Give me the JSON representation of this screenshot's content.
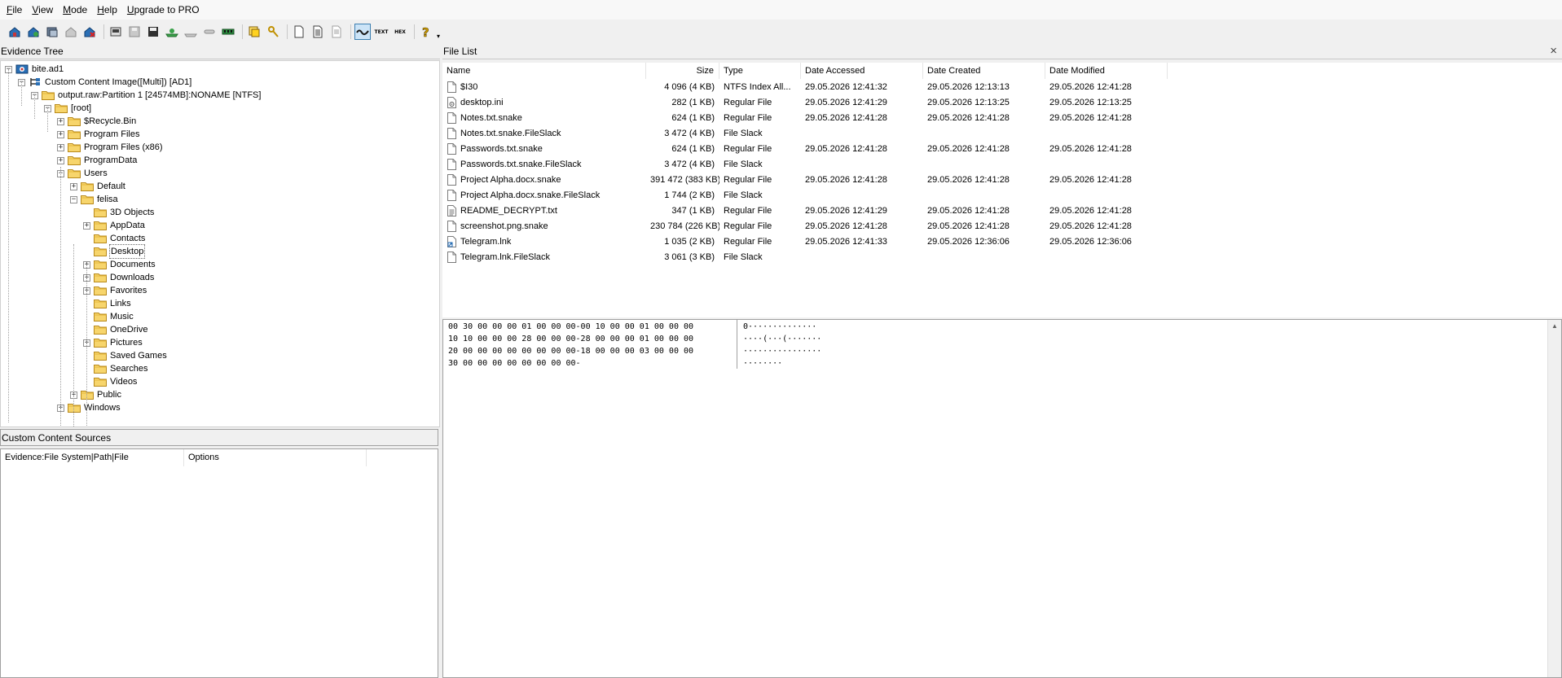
{
  "menu": [
    {
      "pre": "",
      "u": "F",
      "post": "ile"
    },
    {
      "pre": "",
      "u": "V",
      "post": "iew"
    },
    {
      "pre": "",
      "u": "M",
      "post": "ode"
    },
    {
      "pre": "",
      "u": "H",
      "post": "elp"
    },
    {
      "pre": "",
      "u": "U",
      "post": "pgrade to PRO"
    }
  ],
  "evidence_tree": {
    "title": "Evidence Tree",
    "nodes": [
      {
        "label": "bite.ad1",
        "level": 0,
        "exp": "-",
        "icon": "evidence-icon"
      },
      {
        "label": "Custom Content Image([Multi]) [AD1]",
        "level": 1,
        "exp": "-",
        "icon": "tree-icon"
      },
      {
        "label": "output.raw:Partition 1 [24574MB]:NONAME [NTFS]",
        "level": 2,
        "exp": "-",
        "icon": "folder-icon"
      },
      {
        "label": "[root]",
        "level": 3,
        "exp": "-",
        "icon": "folder-icon"
      },
      {
        "label": "$Recycle.Bin",
        "level": 4,
        "exp": "+",
        "icon": "folder-icon"
      },
      {
        "label": "Program Files",
        "level": 4,
        "exp": "+",
        "icon": "folder-icon"
      },
      {
        "label": "Program Files (x86)",
        "level": 4,
        "exp": "+",
        "icon": "folder-icon"
      },
      {
        "label": "ProgramData",
        "level": 4,
        "exp": "+",
        "icon": "folder-icon"
      },
      {
        "label": "Users",
        "level": 4,
        "exp": "-",
        "icon": "folder-icon"
      },
      {
        "label": "Default",
        "level": 5,
        "exp": "+",
        "icon": "folder-icon"
      },
      {
        "label": "felisa",
        "level": 5,
        "exp": "-",
        "icon": "folder-icon"
      },
      {
        "label": "3D Objects",
        "level": 6,
        "exp": "",
        "icon": "folder-icon"
      },
      {
        "label": "AppData",
        "level": 6,
        "exp": "+",
        "icon": "folder-icon"
      },
      {
        "label": "Contacts",
        "level": 6,
        "exp": "",
        "icon": "folder-icon"
      },
      {
        "label": "Desktop",
        "level": 6,
        "exp": "",
        "icon": "folder-icon",
        "selected": true
      },
      {
        "label": "Documents",
        "level": 6,
        "exp": "+",
        "icon": "folder-icon"
      },
      {
        "label": "Downloads",
        "level": 6,
        "exp": "+",
        "icon": "folder-icon"
      },
      {
        "label": "Favorites",
        "level": 6,
        "exp": "+",
        "icon": "folder-icon"
      },
      {
        "label": "Links",
        "level": 6,
        "exp": "",
        "icon": "folder-icon"
      },
      {
        "label": "Music",
        "level": 6,
        "exp": "",
        "icon": "folder-icon"
      },
      {
        "label": "OneDrive",
        "level": 6,
        "exp": "",
        "icon": "folder-icon"
      },
      {
        "label": "Pictures",
        "level": 6,
        "exp": "+",
        "icon": "folder-icon"
      },
      {
        "label": "Saved Games",
        "level": 6,
        "exp": "",
        "icon": "folder-icon"
      },
      {
        "label": "Searches",
        "level": 6,
        "exp": "",
        "icon": "folder-icon"
      },
      {
        "label": "Videos",
        "level": 6,
        "exp": "",
        "icon": "folder-icon"
      },
      {
        "label": "Public",
        "level": 5,
        "exp": "+",
        "icon": "folder-icon"
      },
      {
        "label": "Windows",
        "level": 4,
        "exp": "+",
        "icon": "folder-icon"
      }
    ]
  },
  "custom_sources": {
    "title": "Custom Content Sources",
    "columns": [
      "Evidence:File System|Path|File",
      "Options"
    ]
  },
  "file_list": {
    "title": "File List",
    "close_glyph": "×",
    "columns": [
      "Name",
      "Size",
      "Type",
      "Date Accessed",
      "Date Created",
      "Date Modified"
    ],
    "rows": [
      {
        "name": "$I30",
        "size": "4 096 (4 KB)",
        "type": "NTFS Index All...",
        "accessed": "29.05.2026 12:41:32",
        "created": "29.05.2026 12:13:13",
        "modified": "29.05.2026 12:41:28",
        "icon": "file-icon"
      },
      {
        "name": "desktop.ini",
        "size": "282 (1 KB)",
        "type": "Regular File",
        "accessed": "29.05.2026 12:41:29",
        "created": "29.05.2026 12:13:25",
        "modified": "29.05.2026 12:13:25",
        "icon": "settings-file-icon"
      },
      {
        "name": "Notes.txt.snake",
        "size": "624 (1 KB)",
        "type": "Regular File",
        "accessed": "29.05.2026 12:41:28",
        "created": "29.05.2026 12:41:28",
        "modified": "29.05.2026 12:41:28",
        "icon": "file-icon"
      },
      {
        "name": "Notes.txt.snake.FileSlack",
        "size": "3 472 (4 KB)",
        "type": "File Slack",
        "accessed": "",
        "created": "",
        "modified": "",
        "icon": "file-icon"
      },
      {
        "name": "Passwords.txt.snake",
        "size": "624 (1 KB)",
        "type": "Regular File",
        "accessed": "29.05.2026 12:41:28",
        "created": "29.05.2026 12:41:28",
        "modified": "29.05.2026 12:41:28",
        "icon": "file-icon"
      },
      {
        "name": "Passwords.txt.snake.FileSlack",
        "size": "3 472 (4 KB)",
        "type": "File Slack",
        "accessed": "",
        "created": "",
        "modified": "",
        "icon": "file-icon"
      },
      {
        "name": "Project Alpha.docx.snake",
        "size": "391 472 (383 KB)",
        "type": "Regular File",
        "accessed": "29.05.2026 12:41:28",
        "created": "29.05.2026 12:41:28",
        "modified": "29.05.2026 12:41:28",
        "icon": "file-icon"
      },
      {
        "name": "Project Alpha.docx.snake.FileSlack",
        "size": "1 744 (2 KB)",
        "type": "File Slack",
        "accessed": "",
        "created": "",
        "modified": "",
        "icon": "file-icon"
      },
      {
        "name": "README_DECRYPT.txt",
        "size": "347 (1 KB)",
        "type": "Regular File",
        "accessed": "29.05.2026 12:41:29",
        "created": "29.05.2026 12:41:28",
        "modified": "29.05.2026 12:41:28",
        "icon": "text-file-icon"
      },
      {
        "name": "screenshot.png.snake",
        "size": "230 784 (226 KB)",
        "type": "Regular File",
        "accessed": "29.05.2026 12:41:28",
        "created": "29.05.2026 12:41:28",
        "modified": "29.05.2026 12:41:28",
        "icon": "file-icon"
      },
      {
        "name": "Telegram.lnk",
        "size": "1 035 (2 KB)",
        "type": "Regular File",
        "accessed": "29.05.2026 12:41:33",
        "created": "29.05.2026 12:36:06",
        "modified": "29.05.2026 12:36:06",
        "icon": "shortcut-icon"
      },
      {
        "name": "Telegram.lnk.FileSlack",
        "size": "3 061 (3 KB)",
        "type": "File Slack",
        "accessed": "",
        "created": "",
        "modified": "",
        "icon": "file-icon"
      }
    ]
  },
  "hex_view": {
    "lines": [
      {
        "hex": "00 30 00 00 00 01 00 00 00-00 10 00 00 01 00 00 00",
        "ascii": "0··············"
      },
      {
        "hex": "10 10 00 00 00 28 00 00 00-28 00 00 00 01 00 00 00",
        "ascii": "····(···(·······"
      },
      {
        "hex": "20 00 00 00 00 00 00 00 00-18 00 00 00 03 00 00 00",
        "ascii": "················"
      },
      {
        "hex": "30 00 00 00 00 00 00 00 00-",
        "ascii": "········"
      }
    ],
    "scroll_up_glyph": "▲"
  },
  "toolbar": {
    "icons": [
      "add-evidence-icon",
      "add-all-drives-icon",
      "image-mounting-icon",
      "remove-evidence-icon",
      "remove-all-evidence-icon",
      "create-disk-image-icon",
      "save-icon",
      "export-files-icon",
      "export-hashes-icon",
      "export-directory-icon",
      "decrypt-icon",
      "memory-capture-icon",
      "obtain-protected-files-icon",
      "detect-encryption-icon",
      "new-file-icon",
      "file-properties-icon",
      "file-info-icon",
      "auto-view-icon",
      "text-view-icon",
      "hex-view-icon",
      "help-icon"
    ],
    "text_label": "TEXT",
    "hex_label": "HEX"
  }
}
